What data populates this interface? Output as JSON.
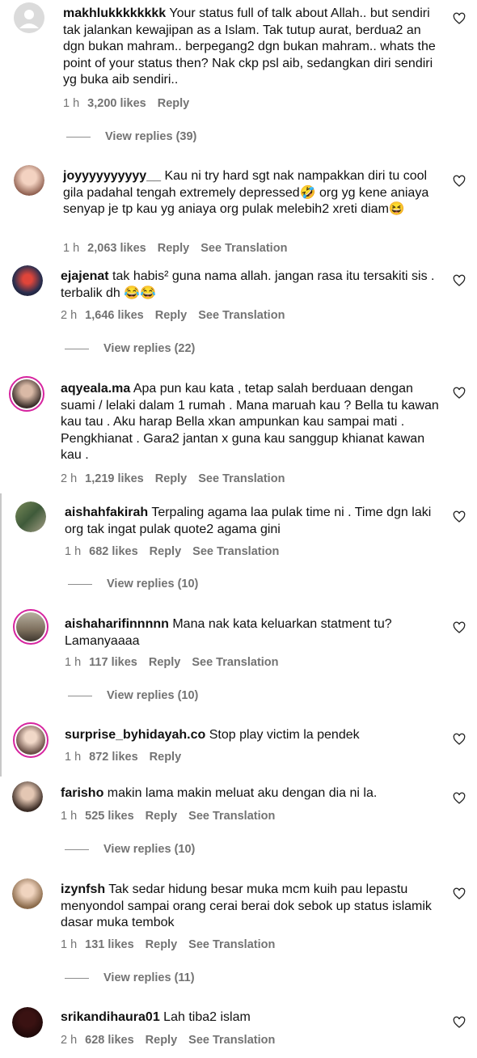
{
  "comments": [
    {
      "username": "makhlukkkkkkkk",
      "text": " Your status full of talk about Allah.. but sendiri tak jalankan kewajipan as a Islam. Tak tutup aurat, berdua2 an dgn bukan mahram.. berpegang2 dgn bukan mahram.. whats the point of your status then? Nak ckp psl aib, sedangkan diri sendiri yg buka aib sendiri..",
      "time": "1 h",
      "likes": "3,200 likes",
      "reply": "Reply",
      "translation": "",
      "view_replies": "View replies (39)"
    },
    {
      "username": "joyyyyyyyyyy__",
      "text": " Kau ni try hard sgt nak nampakkan diri tu cool gila padahal tengah extremely depressed🤣 org yg kene aniaya senyap je tp kau yg aniaya org pulak melebih2 xreti diam😆",
      "time": "1 h",
      "likes": "2,063 likes",
      "reply": "Reply",
      "translation": "See Translation",
      "view_replies": ""
    },
    {
      "username": "ejajenat",
      "text": " tak habis² guna nama allah. jangan rasa itu tersakiti sis . terbalik dh 😂😂",
      "time": "2 h",
      "likes": "1,646 likes",
      "reply": "Reply",
      "translation": "See Translation",
      "view_replies": "View replies (22)"
    },
    {
      "username": "aqyeala.ma",
      "text": " Apa pun kau kata , tetap salah berduaan dengan suami / lelaki dalam 1 rumah . Mana maruah kau ? Bella tu kawan kau tau . Aku harap Bella xkan ampunkan kau sampai mati . Pengkhianat . Gara2 jantan x guna kau sanggup khianat kawan kau .",
      "time": "2 h",
      "likes": "1,219 likes",
      "reply": "Reply",
      "translation": "See Translation",
      "view_replies": ""
    },
    {
      "username": "aishahfakirah",
      "text": " Terpaling agama laa pulak time ni . Time dgn laki org tak ingat pulak quote2 agama gini",
      "time": "1 h",
      "likes": "682 likes",
      "reply": "Reply",
      "translation": "See Translation",
      "view_replies": "View replies (10)"
    },
    {
      "username": "aishaharifinnnnn",
      "text": " Mana nak kata keluarkan statment tu? Lamanyaaaa",
      "time": "1 h",
      "likes": "117 likes",
      "reply": "Reply",
      "translation": "See Translation",
      "view_replies": "View replies (10)"
    },
    {
      "username": "surprise_byhidayah.co",
      "text": " Stop play victim la pendek",
      "time": "1 h",
      "likes": "872 likes",
      "reply": "Reply",
      "translation": "",
      "view_replies": ""
    },
    {
      "username": "farisho",
      "text": " makin lama makin meluat aku dengan dia ni la.",
      "time": "1 h",
      "likes": "525 likes",
      "reply": "Reply",
      "translation": "See Translation",
      "view_replies": "View replies (10)"
    },
    {
      "username": "izynfsh",
      "text": " Tak sedar hidung besar muka mcm kuih pau lepastu menyondol sampai orang cerai berai dok sebok up status islamik dasar muka tembok",
      "time": "1 h",
      "likes": "131 likes",
      "reply": "Reply",
      "translation": "See Translation",
      "view_replies": "View replies (11)"
    },
    {
      "username": "srikandihaura01",
      "text": " Lah tiba2 islam",
      "time": "2 h",
      "likes": "628 likes",
      "reply": "Reply",
      "translation": "See Translation",
      "view_replies": ""
    }
  ]
}
